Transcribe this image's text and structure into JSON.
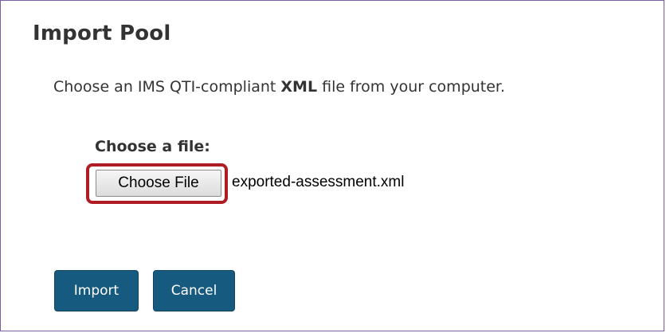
{
  "dialog": {
    "title": "Import Pool",
    "instructions": {
      "before": "Choose an IMS QTI-compliant ",
      "emphasis": "XML",
      "after": " file from your computer."
    },
    "file_label": "Choose a file:",
    "choose_file_label": "Choose File",
    "selected_file": "exported-assessment.xml",
    "import_label": "Import",
    "cancel_label": "Cancel"
  },
  "colors": {
    "border": "#7a5fa0",
    "button_bg": "#175a80",
    "highlight": "#b01c24"
  }
}
